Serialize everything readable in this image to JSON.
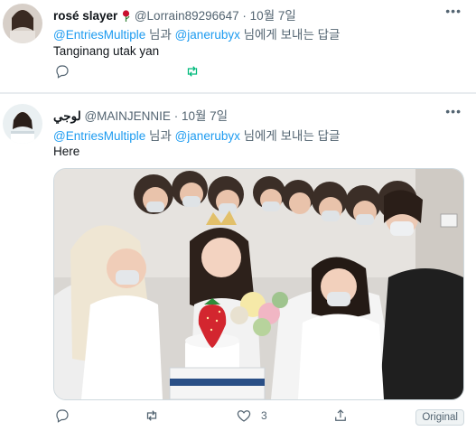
{
  "tweets": [
    {
      "name": "rosé slayer",
      "handle": "@Lorrain89296647",
      "dot": "·",
      "date": "10월 7일",
      "reply_to_a": "@EntriesMultiple",
      "reply_and": " 님과 ",
      "reply_to_b": "@janerubyx",
      "reply_suffix": " 님에게 보내는 답글",
      "text": "Tanginang utak yan"
    },
    {
      "name": "ﻟﻮﺟﻲ",
      "handle": "@MAINJENNIE",
      "dot": "·",
      "date": "10월 7일",
      "reply_to_a": "@EntriesMultiple",
      "reply_and": " 님과 ",
      "reply_to_b": "@janerubyx",
      "reply_suffix": " 님에게 보내는 답글",
      "text": "Here",
      "like_count": "3",
      "original_label": "Original"
    }
  ],
  "colors": {
    "accent": "#1d9bf0",
    "muted": "#536471",
    "rose": "#c8102e"
  }
}
